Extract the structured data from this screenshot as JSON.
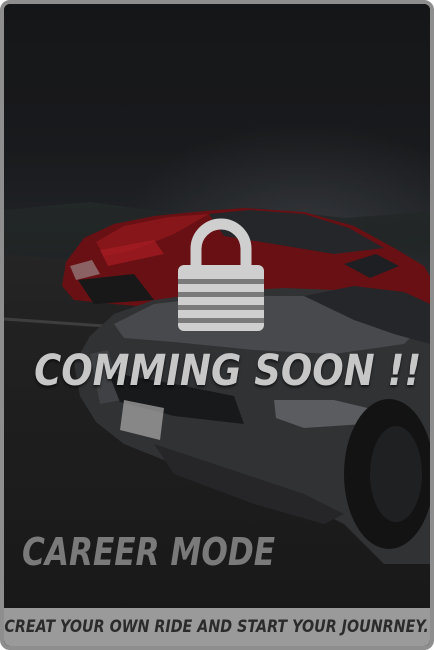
{
  "card": {
    "status_text": "COMMING SOON !!",
    "mode_title": "CAREER MODE",
    "tagline": "CREAT YOUR OWN RIDE AND START YOUR JOUNRNEY.",
    "lock_icon": "lock-icon",
    "locked": true
  },
  "colors": {
    "frame": "#8e8e8e",
    "footer_bg": "#9a9a9a",
    "headline": "#c7c7c7",
    "mode_title": "#7a7a7a",
    "lock": "#cfcfcf",
    "red_car": "#b3151b",
    "silver_car": "#5a5c60"
  }
}
